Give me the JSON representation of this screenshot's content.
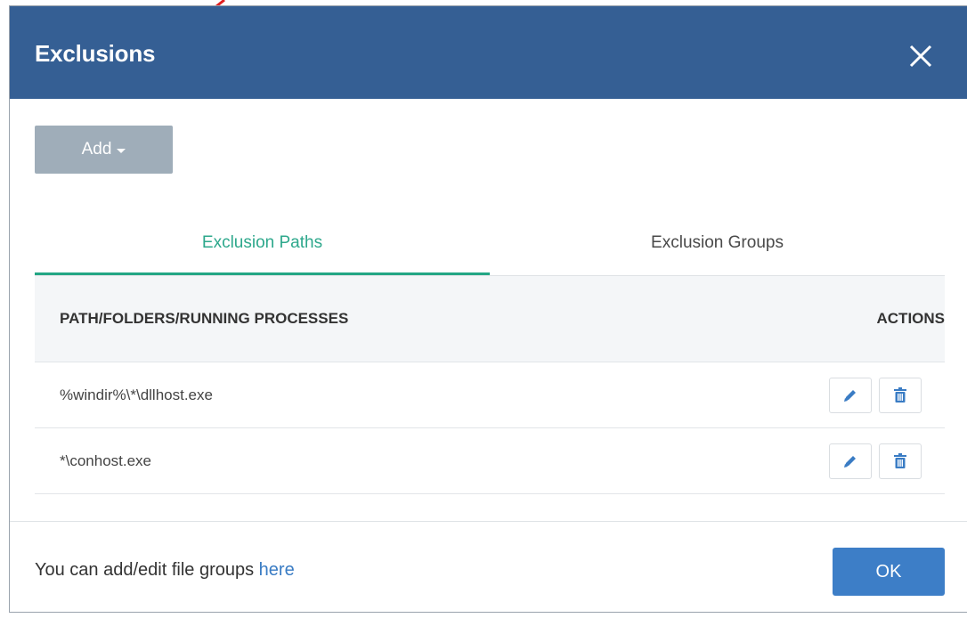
{
  "dialog": {
    "title": "Exclusions",
    "close_icon": "close-icon",
    "header_color": "#355f94"
  },
  "toolbar": {
    "add_label": "Add"
  },
  "tabs": [
    {
      "label": "Exclusion Paths",
      "active": true
    },
    {
      "label": "Exclusion Groups",
      "active": false
    }
  ],
  "table": {
    "headers": {
      "path": "PATH/FOLDERS/RUNNING PROCESSES",
      "actions": "ACTIONS"
    },
    "rows": [
      {
        "path": "%windir%\\*\\dllhost.exe",
        "edit_icon": "pencil-icon",
        "delete_icon": "trash-icon"
      },
      {
        "path": "*\\conhost.exe",
        "edit_icon": "pencil-icon",
        "delete_icon": "trash-icon"
      }
    ]
  },
  "footer": {
    "text": "You can add/edit file groups ",
    "link_text": "here",
    "ok_label": "OK"
  },
  "colors": {
    "accent_tab": "#2ea88c",
    "ok_button": "#3d7ec7",
    "add_button": "#9fadb9",
    "link": "#3a7cc4",
    "annotation_arrow": "#e02020"
  }
}
